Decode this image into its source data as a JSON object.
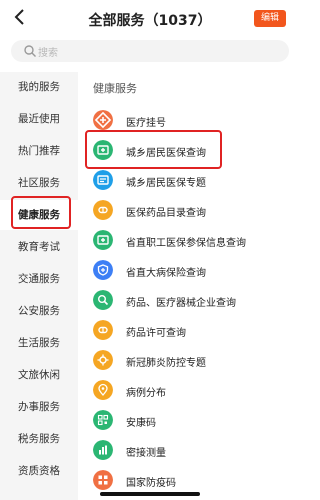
{
  "header": {
    "title": "全部服务（1037）",
    "edit_label": "编辑"
  },
  "search": {
    "placeholder": "搜索"
  },
  "sidebar": {
    "items": [
      {
        "label": "我的服务"
      },
      {
        "label": "最近使用"
      },
      {
        "label": "热门推荐"
      },
      {
        "label": "社区服务"
      },
      {
        "label": "健康服务",
        "active": true
      },
      {
        "label": "教育考试"
      },
      {
        "label": "交通服务"
      },
      {
        "label": "公安服务"
      },
      {
        "label": "生活服务"
      },
      {
        "label": "文旅休闲"
      },
      {
        "label": "办事服务"
      },
      {
        "label": "税务服务"
      },
      {
        "label": "资质资格"
      }
    ]
  },
  "main": {
    "section_title": "健康服务",
    "services": [
      {
        "label": "医疗挂号",
        "icon": "hospital-icon",
        "color": "#f07043"
      },
      {
        "label": "城乡居民医保查询",
        "icon": "medical-card-icon",
        "color": "#2bb673",
        "highlighted": true
      },
      {
        "label": "城乡居民医保专题",
        "icon": "medical-card-icon",
        "color": "#1f9fe8"
      },
      {
        "label": "医保药品目录查询",
        "icon": "pill-icon",
        "color": "#f5a623"
      },
      {
        "label": "省直职工医保参保信息查询",
        "icon": "medical-card-icon",
        "color": "#2bb673"
      },
      {
        "label": "省直大病保险查询",
        "icon": "shield-icon",
        "color": "#3d7ff5"
      },
      {
        "label": "药品、医疗器械企业查询",
        "icon": "search-icon",
        "color": "#2bb673"
      },
      {
        "label": "药品许可查询",
        "icon": "pill-icon",
        "color": "#f5a623"
      },
      {
        "label": "新冠肺炎防控专题",
        "icon": "virus-icon",
        "color": "#f5a623"
      },
      {
        "label": "病例分布",
        "icon": "location-icon",
        "color": "#f5a623"
      },
      {
        "label": "安康码",
        "icon": "qr-code-icon",
        "color": "#2bb673"
      },
      {
        "label": "密接测量",
        "icon": "chart-icon",
        "color": "#2bb673"
      },
      {
        "label": "国家防疫码",
        "icon": "grid-icon",
        "color": "#f07043"
      }
    ]
  },
  "colors": {
    "accent": "#f2561d",
    "highlight_border": "#e02323"
  }
}
